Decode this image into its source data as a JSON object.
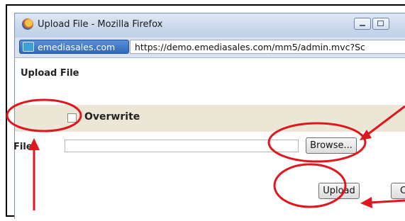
{
  "window": {
    "title": "Upload File - Mozilla Firefox",
    "icon": "firefox-icon",
    "controls": [
      "minimize-icon",
      "maximize-icon"
    ]
  },
  "address_bar": {
    "site_identity": "emediasales.com",
    "url": "https://demo.emediasales.com/mm5/admin.mvc?Sc"
  },
  "form": {
    "heading": "Upload File",
    "overwrite_label": "Overwrite",
    "overwrite_checked": false,
    "file_label": "File:",
    "file_value": "",
    "browse_label": "Browse...",
    "upload_label": "Upload",
    "cancel_label": "C"
  },
  "annotations": {
    "highlight_color": "#e0161c"
  }
}
